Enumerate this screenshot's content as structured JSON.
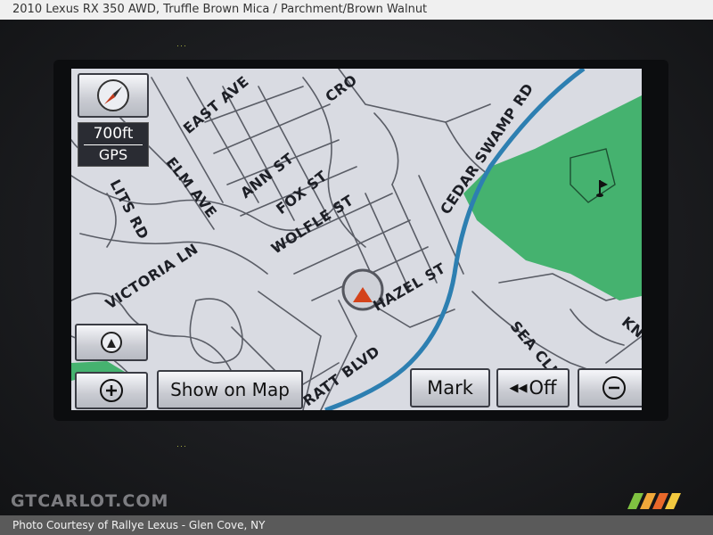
{
  "caption": {
    "title": "2010 Lexus RX 350 AWD,  Truffle Brown Mica / Parchment/Brown Walnut",
    "credit": "Photo Courtesy of Rallye Lexus - Glen Cove, NY",
    "watermark": "GTCARLOT.COM"
  },
  "scale": {
    "distance": "700ft",
    "mode": "GPS"
  },
  "buttons": {
    "show_on_map": "Show on Map",
    "mark": "Mark",
    "guidance_off": "Off"
  },
  "streets": {
    "east_ave": "EAST AVE",
    "elm_ave": "ELM AVE",
    "ann_st": "ANN ST",
    "fox_st": "FOX ST",
    "wolfle_st": "WOLFLE ST",
    "victoria_ln": "VICTORIA LN",
    "hazel_st": "HAZEL ST",
    "ratt_blvd": "RATT BLVD",
    "cedar_swamp_rd": "CEDAR SWAMP RD",
    "sea_clif": "SEA CLIF",
    "lits_rd": "LITS RD",
    "cro": "CRO",
    "kno": "KNO"
  },
  "icons": {
    "compass": "compass-icon",
    "heading_up": "heading-up-icon",
    "zoom_in": "zoom-in-icon",
    "zoom_out": "zoom-out-icon",
    "rewind": "rewind-icon",
    "vehicle": "vehicle-position-icon",
    "golf": "golf-course-icon"
  },
  "colors": {
    "map_background": "#d9dbe2",
    "road": "#5a5d66",
    "highway": "#2d7fb1",
    "park": "#45b26f",
    "vehicle_arrow": "#d4431b"
  }
}
